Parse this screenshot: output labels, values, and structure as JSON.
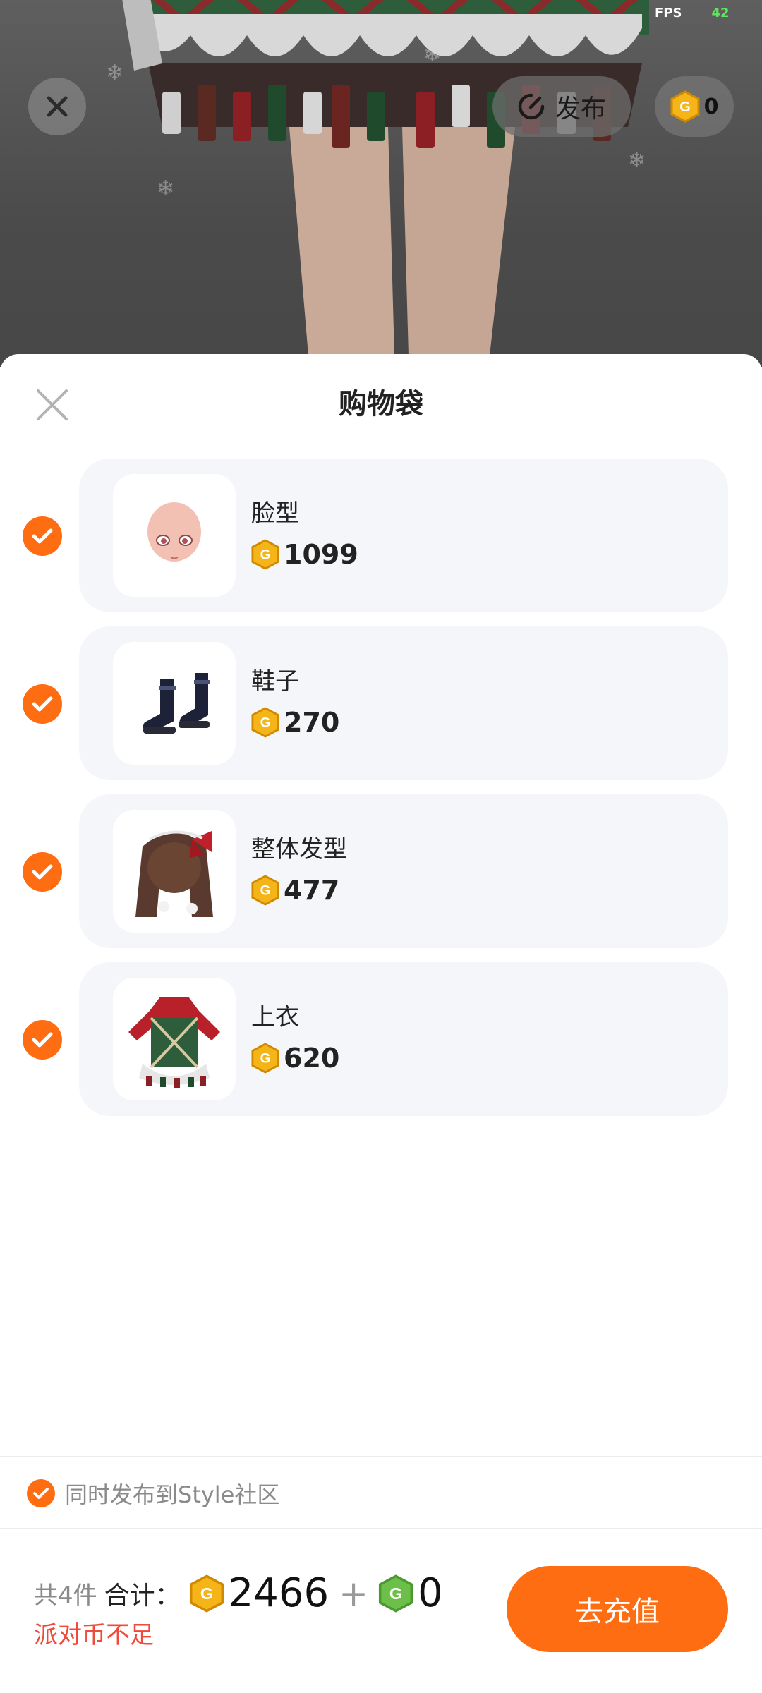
{
  "scene": {
    "fps_label": "FPS",
    "fps_value": "42",
    "publish_label": "发布",
    "coin_balance": "0"
  },
  "sheet": {
    "title": "购物袋",
    "items": [
      {
        "name": "脸型",
        "price": "1099",
        "icon": "face-shape-icon"
      },
      {
        "name": "鞋子",
        "price": "270",
        "icon": "shoes-icon"
      },
      {
        "name": "整体发型",
        "price": "477",
        "icon": "hairstyle-icon"
      },
      {
        "name": "上衣",
        "price": "620",
        "icon": "top-clothing-icon"
      }
    ],
    "publish_to_community": "同时发布到Style社区"
  },
  "footer": {
    "count_text": "共4件",
    "sum_label": "合计：",
    "gold_total": "2466",
    "plus": "+",
    "green_total": "0",
    "warning": "派对币不足",
    "recharge_label": "去充值"
  },
  "colors": {
    "accent": "#ff6d12",
    "warning": "#f04a3c",
    "coin_gold": "#f5b418",
    "coin_green": "#6cc04a"
  }
}
